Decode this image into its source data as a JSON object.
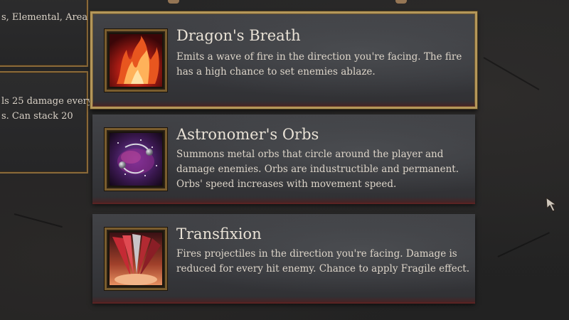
{
  "left_panels": {
    "top_text": "s, Elemental, Area",
    "mid_lines": [
      "ls 25 damage every",
      "s. Can stack 20"
    ]
  },
  "skills": [
    {
      "name": "Dragon's Breath",
      "description_lines": [
        "Emits a wave of fire in the direction you're facing. The fire",
        "has a high chance to set enemies ablaze."
      ],
      "icon": "fire-icon",
      "selected": true
    },
    {
      "name": "Astronomer's Orbs",
      "description_lines": [
        "Summons metal orbs that circle around the player and",
        "damage enemies. Orbs are industructible and permanent.",
        "Orbs' speed increases with movement speed."
      ],
      "icon": "orbs-icon",
      "selected": false
    },
    {
      "name": "Transfixion",
      "description_lines": [
        "Fires projectiles in the direction you're facing. Damage is",
        "reduced for every hit enemy. Chance to apply Fragile effect."
      ],
      "icon": "projectiles-icon",
      "selected": false
    }
  ],
  "colors": {
    "card_gold_border": "#b4975a",
    "text": "#e9e2d6",
    "background": "#242424"
  }
}
